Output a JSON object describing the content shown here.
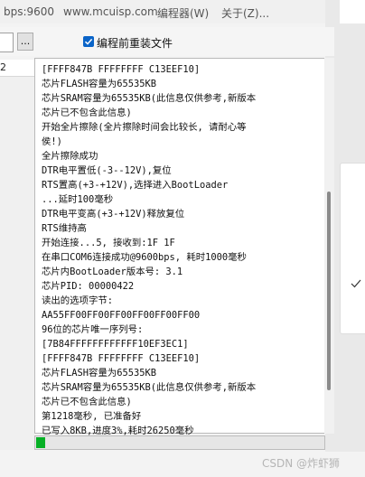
{
  "titlebar": {
    "bps": "bps:9600",
    "url": "www.mcuisp.com",
    "menu_editor": "编程器(W)",
    "menu_about": "关于(Z)..."
  },
  "toolbar": {
    "browse_label": "...",
    "reload_label": "编程前重装文件",
    "reload_checked": true
  },
  "left_strip": {
    "item_number": "2"
  },
  "log": {
    "lines": [
      "[FFFF847B FFFFFFFF C13EEF10]",
      "芯片FLASH容量为65535KB",
      "芯片SRAM容量为65535KB(此信息仅供参考,新版本",
      "芯片已不包含此信息)",
      "开始全片擦除(全片擦除时间会比较长, 请耐心等",
      "侯!)",
      "全片擦除成功",
      "DTR电平置低(-3--12V),复位",
      "RTS置高(+3-+12V),选择进入BootLoader",
      "...延时100毫秒",
      "DTR电平变高(+3-+12V)释放复位",
      "RTS维持高",
      "开始连接...5, 接收到:1F 1F",
      "在串口COM6连接成功@9600bps, 耗时1000毫秒",
      "芯片内BootLoader版本号: 3.1",
      "芯片PID: 00000422",
      "读出的选项字节:",
      "AA55FF00FF00FF00FF00FF00FF00",
      "96位的芯片唯一序列号:",
      "[7B84FFFFFFFFFFFF10EF3EC1]",
      "[FFFF847B FFFFFFFF C13EEF10]",
      "芯片FLASH容量为65535KB",
      "芯片SRAM容量为65535KB(此信息仅供参考,新版本",
      "芯片已不包含此信息)",
      "第1218毫秒, 已准备好",
      "已写入8KB,进度3%,耗时26250毫秒"
    ]
  },
  "progress": {
    "percent": 3,
    "color": "#06b025"
  },
  "watermark": "CSDN @炸虾狮",
  "colors": {
    "accent": "#0a64c8",
    "log_bg": "#ffffff",
    "window_bg": "#f3f3f3"
  },
  "icons": {
    "checkbox": "checkbox-checked-icon",
    "popup_check": "checkmark-icon"
  }
}
